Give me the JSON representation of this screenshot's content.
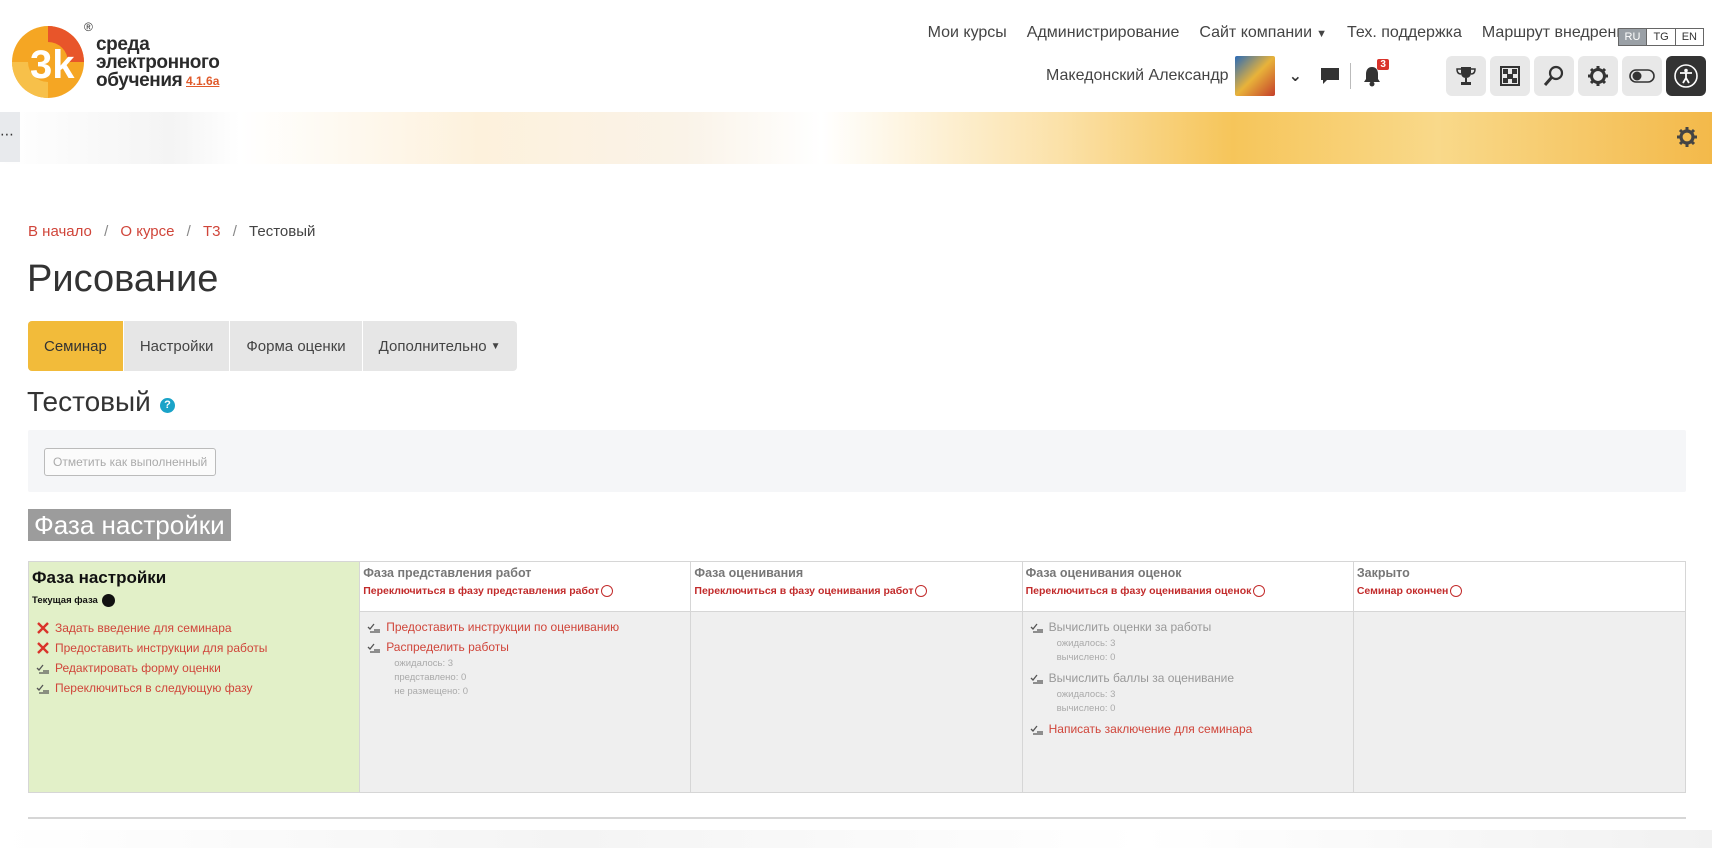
{
  "logo": {
    "line1": "среда",
    "line2": "электронного",
    "line3": "обучения",
    "version": "4.1.6a",
    "reg": "®"
  },
  "topnav": {
    "my_courses": "Мои курсы",
    "admin": "Администрирование",
    "company_site": "Сайт компании",
    "support": "Тех. поддержка",
    "route": "Маршрут внедрения"
  },
  "languages": [
    "RU",
    "TG",
    "EN"
  ],
  "user": {
    "name": "Македонский Александр",
    "notifications": "3"
  },
  "breadcrumb": {
    "home": "В начало",
    "course": "О курсе",
    "t3": "Т3",
    "current": "Тестовый"
  },
  "page_title": "Рисование",
  "tabs": {
    "seminar": "Семинар",
    "settings": "Настройки",
    "form": "Форма оценки",
    "more": "Дополнительно"
  },
  "subtitle": "Тестовый",
  "help_symbol": "?",
  "complete_button": "Отметить как выполненный",
  "phase_heading": "Фаза настройки",
  "phases": {
    "setup": {
      "title": "Фаза настройки",
      "current_label": "Текущая фаза",
      "tasks": [
        "Задать введение для семинара",
        "Предоставить инструкции для работы",
        "Редактировать форму оценки",
        "Переключиться в следующую фазу"
      ]
    },
    "submission": {
      "title": "Фаза представления работ",
      "switch": "Переключиться в фазу представления работ",
      "tasks": [
        "Предоставить инструкции по оцениванию",
        "Распределить работы"
      ],
      "details": [
        "ожидалось: 3",
        "представлено: 0",
        "не размещено: 0"
      ]
    },
    "assessment": {
      "title": "Фаза оценивания",
      "switch": "Переключиться в фазу оценивания работ"
    },
    "evaluation": {
      "title": "Фаза оценивания оценок",
      "switch": "Переключиться в фазу оценивания оценок",
      "tasks": [
        "Вычислить оценки за работы",
        "Вычислить баллы за оценивание",
        "Написать заключение для семинара"
      ],
      "details1": [
        "ожидалось: 3",
        "вычислено: 0"
      ],
      "details2": [
        "ожидалось: 3",
        "вычислено: 0"
      ]
    },
    "closed": {
      "title": "Закрыто",
      "switch": "Семинар окончен"
    }
  },
  "colors": {
    "accent": "#f2bb3a",
    "link": "#d0453a",
    "current_phase_bg": "#e2f0c8",
    "danger": "#c22b2b"
  }
}
